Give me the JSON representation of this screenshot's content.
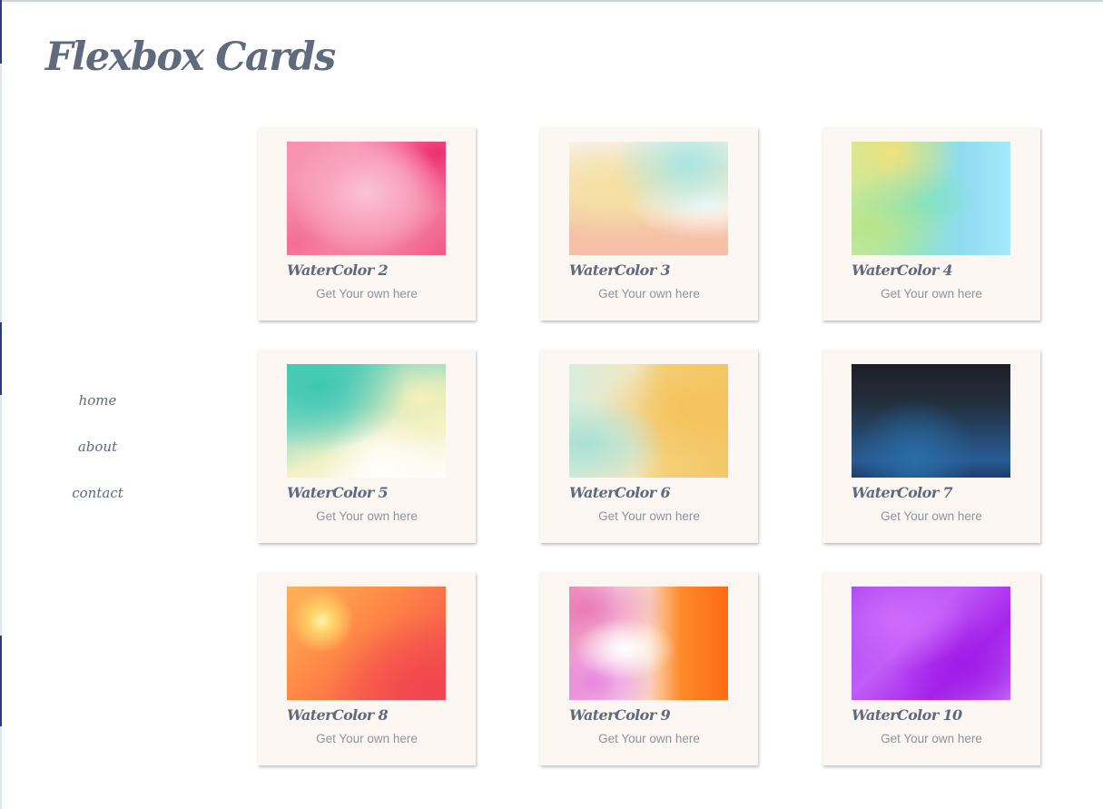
{
  "page": {
    "title": "Flexbox Cards"
  },
  "nav": {
    "items": [
      "home",
      "about",
      "contact"
    ]
  },
  "cards": [
    {
      "title": "WaterColor 2",
      "link": "Get Your own here"
    },
    {
      "title": "WaterColor 3",
      "link": "Get Your own here"
    },
    {
      "title": "WaterColor 4",
      "link": "Get Your own here"
    },
    {
      "title": "WaterColor 5",
      "link": "Get Your own here"
    },
    {
      "title": "WaterColor 6",
      "link": "Get Your own here"
    },
    {
      "title": "WaterColor 7",
      "link": "Get Your own here"
    },
    {
      "title": "WaterColor 8",
      "link": "Get Your own here"
    },
    {
      "title": "WaterColor 9",
      "link": "Get Your own here"
    },
    {
      "title": "WaterColor 10",
      "link": "Get Your own here"
    }
  ],
  "colors": {
    "text": "#5f6b7d",
    "card_bg": "#fdf7f4",
    "link": "#8f939a"
  }
}
